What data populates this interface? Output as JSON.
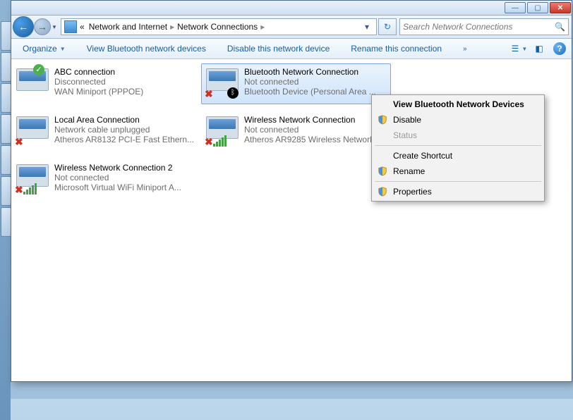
{
  "breadcrumb": {
    "prefix": "«",
    "items": [
      "Network and Internet",
      "Network Connections"
    ]
  },
  "search": {
    "placeholder": "Search Network Connections"
  },
  "toolbar": {
    "organize": "Organize",
    "btn1": "View Bluetooth network devices",
    "btn2": "Disable this network device",
    "btn3": "Rename this connection"
  },
  "connections": [
    {
      "title": "ABC connection",
      "sub1": "Disconnected",
      "sub2": "WAN Miniport (PPPOE)",
      "status_icon": "ok",
      "selected": false
    },
    {
      "title": "Bluetooth Network Connection",
      "sub1": "Not connected",
      "sub2": "Bluetooth Device (Personal Area ...",
      "status_icon": "x-bt",
      "selected": true
    },
    {
      "title": "Local Area Connection",
      "sub1": "Network cable unplugged",
      "sub2": "Atheros AR8132 PCI-E Fast Ethern...",
      "status_icon": "x",
      "selected": false
    },
    {
      "title": "Wireless Network Connection",
      "sub1": "Not connected",
      "sub2": "Atheros AR9285 Wireless Network...",
      "status_icon": "x-sig",
      "selected": false
    },
    {
      "title": "Wireless Network Connection 2",
      "sub1": "Not connected",
      "sub2": "Microsoft Virtual WiFi Miniport A...",
      "status_icon": "x-sig",
      "selected": false
    }
  ],
  "context_menu": {
    "items": [
      {
        "label": "View Bluetooth Network Devices",
        "bold": true,
        "shield": false,
        "sep_after": false,
        "disabled": false
      },
      {
        "label": "Disable",
        "bold": false,
        "shield": true,
        "sep_after": false,
        "disabled": false
      },
      {
        "label": "Status",
        "bold": false,
        "shield": false,
        "sep_after": true,
        "disabled": true
      },
      {
        "label": "Create Shortcut",
        "bold": false,
        "shield": false,
        "sep_after": false,
        "disabled": false
      },
      {
        "label": "Rename",
        "bold": false,
        "shield": true,
        "sep_after": true,
        "disabled": false
      },
      {
        "label": "Properties",
        "bold": false,
        "shield": true,
        "sep_after": false,
        "disabled": false
      }
    ]
  }
}
